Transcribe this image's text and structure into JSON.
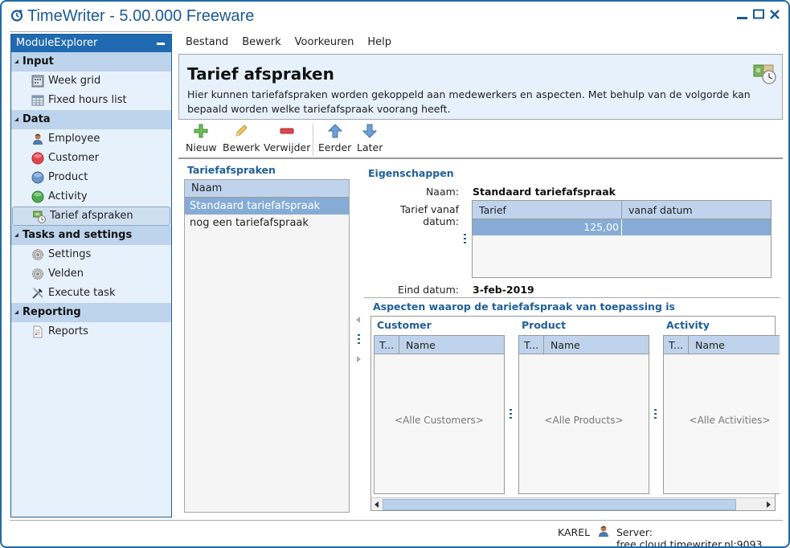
{
  "window": {
    "title": "TimeWriter - 5.00.000 Freeware",
    "controls": [
      "minimize",
      "maximize",
      "close"
    ]
  },
  "sidebar": {
    "title": "ModuleExplorer",
    "groups": [
      {
        "label": "Input",
        "items": [
          {
            "label": "Week grid",
            "icon": "calendar-icon"
          },
          {
            "label": "Fixed hours list",
            "icon": "table-icon"
          }
        ]
      },
      {
        "label": "Data",
        "items": [
          {
            "label": "Employee",
            "icon": "person-icon"
          },
          {
            "label": "Customer",
            "icon": "red-circle-icon"
          },
          {
            "label": "Product",
            "icon": "blue-circle-icon"
          },
          {
            "label": "Activity",
            "icon": "green-circle-icon"
          },
          {
            "label": "Tarief afspraken",
            "icon": "money-clock-icon",
            "active": true
          }
        ]
      },
      {
        "label": "Tasks and settings",
        "items": [
          {
            "label": "Settings",
            "icon": "gear-icon"
          },
          {
            "label": "Velden",
            "icon": "gear-icon"
          },
          {
            "label": "Execute task",
            "icon": "tools-icon"
          }
        ]
      },
      {
        "label": "Reporting",
        "items": [
          {
            "label": "Reports",
            "icon": "report-icon"
          }
        ]
      }
    ]
  },
  "menu": [
    "Bestand",
    "Bewerk",
    "Voorkeuren",
    "Help"
  ],
  "header": {
    "title": "Tarief afspraken",
    "description": "Hier kunnen tariefafspraken worden gekoppeld aan medewerkers en aspecten. Met behulp van de volgorde kan bepaald worden welke tariefafspraak voorang heeft."
  },
  "toolbar": {
    "new": "Nieuw",
    "edit": "Bewerk",
    "delete": "Verwijder",
    "earlier": "Eerder",
    "later": "Later"
  },
  "list": {
    "title": "Tariefafspraken",
    "column": "Naam",
    "rows": [
      "Standaard tariefafspraak",
      "nog een tariefafspraak"
    ],
    "selected_index": 0
  },
  "properties": {
    "title": "Eigenschappen",
    "name_label": "Naam:",
    "name_value": "Standaard tariefafspraak",
    "rate_label": "Tarief vanaf datum:",
    "rate_columns": [
      "Tarief",
      "vanaf datum"
    ],
    "rate_rows": [
      {
        "tarief": "125,00",
        "vanaf": ""
      }
    ],
    "end_label": "Eind datum:",
    "end_value": "3-feb-2019"
  },
  "aspects": {
    "title": "Aspecten waarop de tariefafspraak van toepassing is",
    "columns": [
      {
        "title": "Customer",
        "col1": "T...",
        "col2": "Name",
        "empty": "<Alle Customers>"
      },
      {
        "title": "Product",
        "col1": "T...",
        "col2": "Name",
        "empty": "<Alle Products>"
      },
      {
        "title": "Activity",
        "col1": "T...",
        "col2": "Name",
        "empty": "<Alle Activities>"
      }
    ]
  },
  "status": {
    "user": "KAREL",
    "server": "Server: free.cloud.timewriter.nl:9093"
  }
}
